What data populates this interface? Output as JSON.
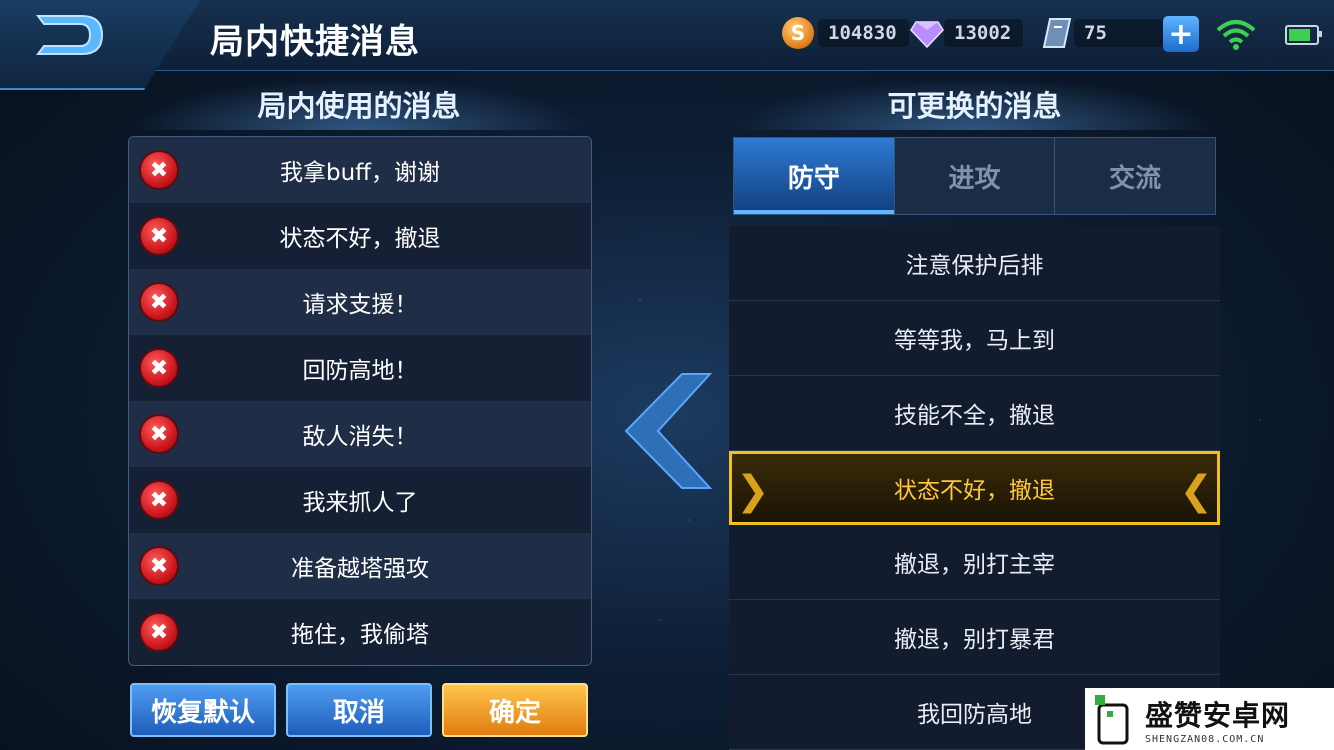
{
  "header": {
    "title": "局内快捷消息",
    "gold": "104830",
    "diamond": "13002",
    "coupon": "75"
  },
  "left_panel": {
    "title": "局内使用的消息",
    "messages": [
      "我拿buff，谢谢",
      "状态不好，撤退",
      "请求支援！",
      "回防高地！",
      "敌人消失！",
      "我来抓人了",
      "准备越塔强攻",
      "拖住，我偷塔"
    ]
  },
  "buttons": {
    "restore": "恢复默认",
    "cancel": "取消",
    "confirm": "确定"
  },
  "right_panel": {
    "title": "可更换的消息",
    "tabs": [
      "防守",
      "进攻",
      "交流"
    ],
    "active_tab": "防守",
    "messages": [
      "注意保护后排",
      "等等我，马上到",
      "技能不全，撤退",
      "状态不好，撤退",
      "撤退，别打主宰",
      "撤退，别打暴君",
      "我回防高地"
    ],
    "selected_message": "状态不好，撤退"
  },
  "watermark": {
    "main": "盛赞安卓网",
    "sub": "SHENGZAN08.COM.CN"
  },
  "colors": {
    "selected": "#ffc83a",
    "accent": "#2f7ad4",
    "confirm": "#e07c10"
  }
}
